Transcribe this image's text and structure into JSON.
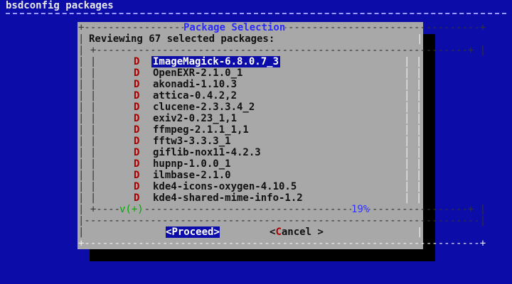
{
  "backtitle": "bsdconfig packages",
  "dialog": {
    "title": "Package Selection",
    "prompt": "Reviewing 67 selected packages:",
    "scroll_indicator": "v(+)",
    "percent": "19%"
  },
  "packages": [
    {
      "flag": "D",
      "name": "ImageMagick-6.8.0.7_3"
    },
    {
      "flag": "D",
      "name": "OpenEXR-2.1.0_1"
    },
    {
      "flag": "D",
      "name": "akonadi-1.10.3"
    },
    {
      "flag": "D",
      "name": "attica-0.4.2,2"
    },
    {
      "flag": "D",
      "name": "clucene-2.3.3.4_2"
    },
    {
      "flag": "D",
      "name": "exiv2-0.23_1,1"
    },
    {
      "flag": "D",
      "name": "ffmpeg-2.1.1_1,1"
    },
    {
      "flag": "D",
      "name": "fftw3-3.3.3_1"
    },
    {
      "flag": "D",
      "name": "giflib-nox11-4.2.3"
    },
    {
      "flag": "D",
      "name": "hupnp-1.0.0_1"
    },
    {
      "flag": "D",
      "name": "ilmbase-2.1.0"
    },
    {
      "flag": "D",
      "name": "kde4-icons-oxygen-4.10.5"
    },
    {
      "flag": "D",
      "name": "kde4-shared-mime-info-1.2"
    }
  ],
  "buttons": {
    "proceed": {
      "open": "<",
      "hot": "P",
      "rest": "roceed",
      "close": ">"
    },
    "cancel": {
      "open": "<",
      "hot": "C",
      "rest": "ancel",
      "close": " >"
    }
  },
  "colors": {
    "background": "#0c0ca8",
    "dialog": "#a8a8a8",
    "shadow": "#000000",
    "title": "#2a2aff",
    "selection": "#0c0ca8",
    "hotkey": "#a80000"
  }
}
